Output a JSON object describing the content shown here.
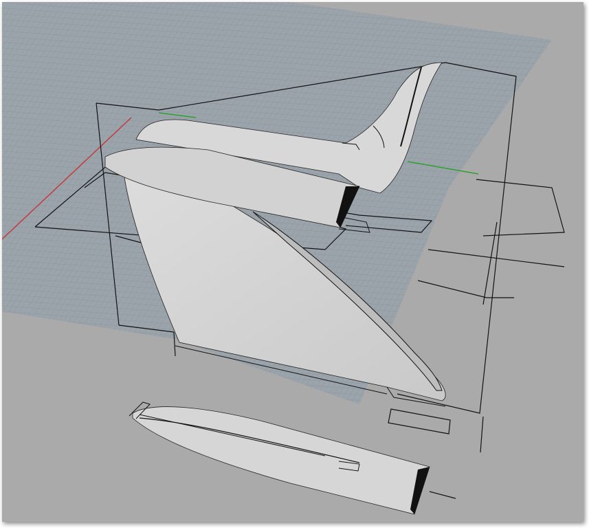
{
  "viewport": {
    "view": "perspective",
    "background_color": "#aaaaaa",
    "grid_color": "#8f979f",
    "x_axis_color": "#c43a3a",
    "y_axis_color": "#2ea02e",
    "surface_color": "#d4d4d4",
    "wire_color": "#111111"
  },
  "scene": {
    "objects": [
      "seat-back-and-backrest",
      "chair-side-panel",
      "seat-board",
      "base-runner",
      "loose-board",
      "bounding-box"
    ]
  }
}
